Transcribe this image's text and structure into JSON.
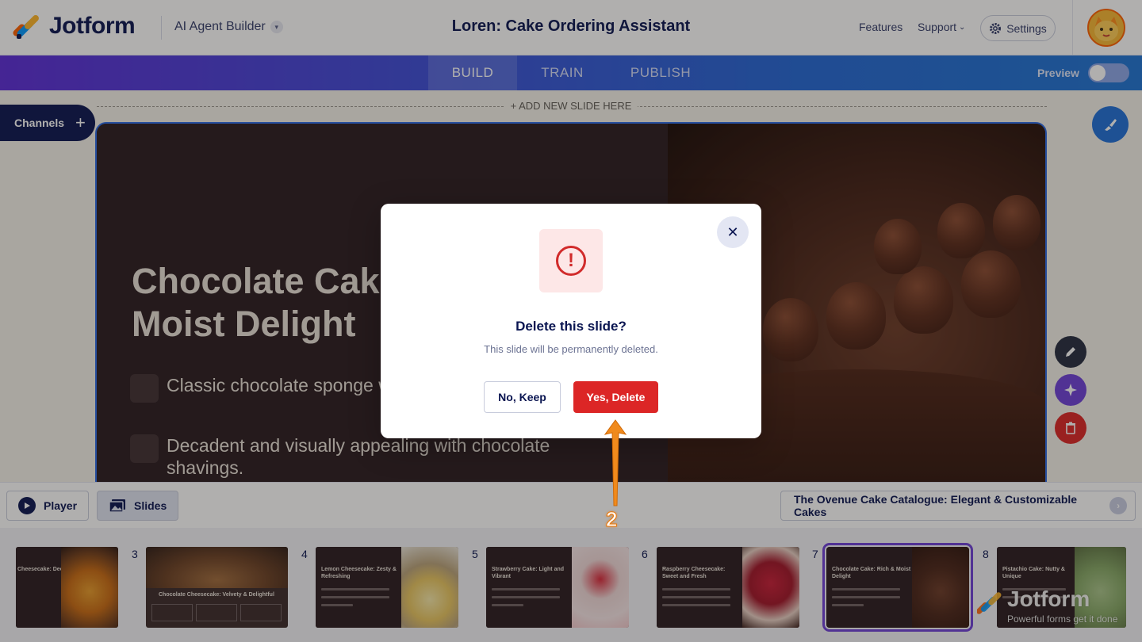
{
  "header": {
    "brand": "Jotform",
    "builder_label": "AI Agent Builder",
    "page_title": "Loren: Cake Ordering Assistant",
    "features_label": "Features",
    "support_label": "Support",
    "settings_label": "Settings"
  },
  "tabs": {
    "build": "BUILD",
    "train": "TRAIN",
    "publish": "PUBLISH",
    "active": "BUILD",
    "preview_label": "Preview"
  },
  "canvas": {
    "add_slide_label": "+ ADD NEW SLIDE HERE",
    "channels_label": "Channels",
    "slide": {
      "title_line1": "Chocolate Cake: Rich &",
      "title_line2": "Moist Delight",
      "bullets": [
        "Classic chocolate sponge with chocolate frosting.",
        "Decadent and visually appealing with chocolate shavings."
      ]
    }
  },
  "modal": {
    "title": "Delete this slide?",
    "subtitle": "This slide will be permanently deleted.",
    "keep_label": "No, Keep",
    "delete_label": "Yes, Delete"
  },
  "bottombar": {
    "player_label": "Player",
    "slides_label": "Slides",
    "catalogue_title": "The Ovenue Cake Catalogue: Elegant & Customizable Cakes"
  },
  "thumbnails": [
    {
      "num": "",
      "title": "Cheesecake: Decadent"
    },
    {
      "num": "3",
      "title": "Chocolate Cheesecake: Velvety & Delightful"
    },
    {
      "num": "4",
      "title": "Lemon Cheesecake: Zesty & Refreshing"
    },
    {
      "num": "5",
      "title": "Strawberry Cake: Light and Vibrant"
    },
    {
      "num": "6",
      "title": "Raspberry Cheesecake: Sweet and Fresh"
    },
    {
      "num": "7",
      "title": "Chocolate Cake: Rich & Moist Delight"
    },
    {
      "num": "8",
      "title": "Pistachio Cake: Nutty & Unique"
    }
  ],
  "watermark": {
    "brand": "Jotform",
    "tagline": "Powerful forms get it done"
  },
  "annotation": {
    "step_number": "2"
  },
  "colors": {
    "navy": "#0a1551",
    "danger": "#dc2626",
    "accent_purple": "#6d3fd7",
    "annotation_orange": "#f08a1c"
  }
}
